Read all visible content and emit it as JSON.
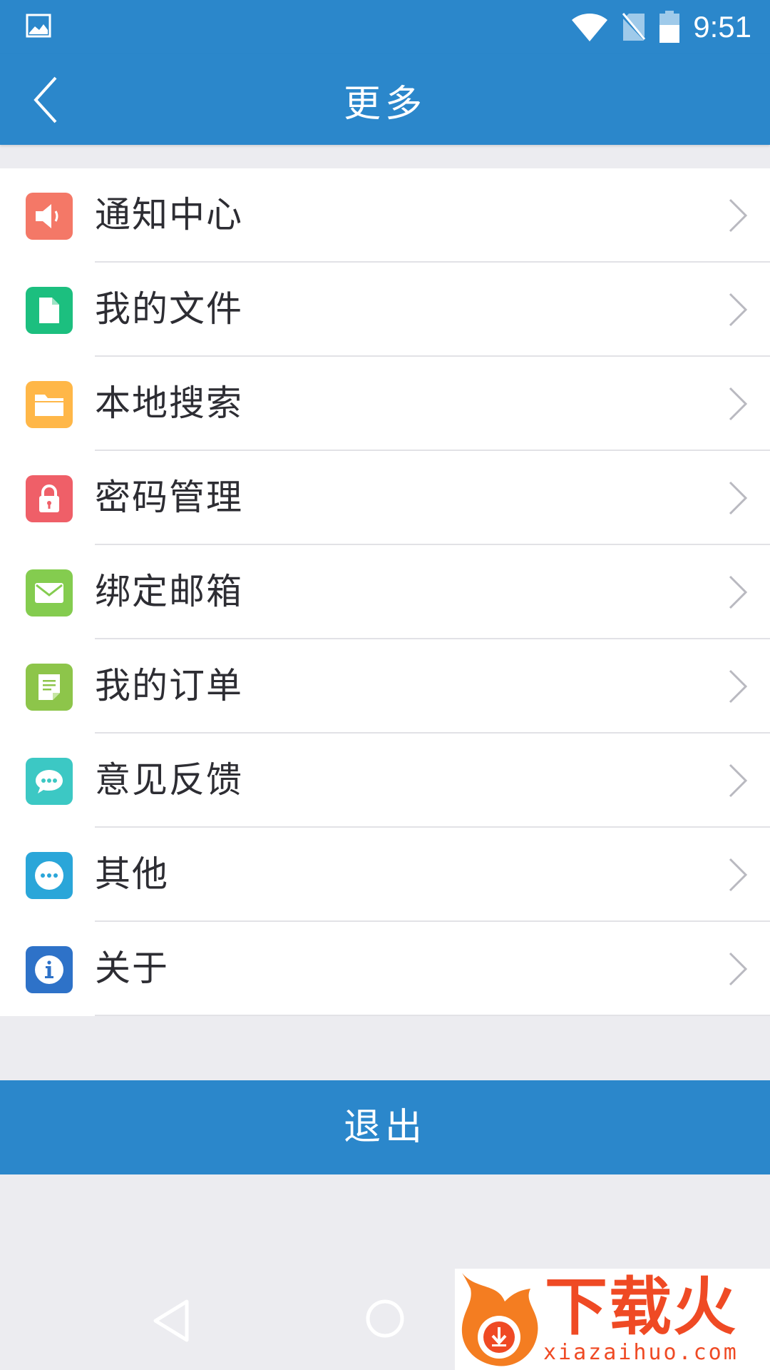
{
  "status_bar": {
    "time": "9:51",
    "icons": [
      "image-notification-icon",
      "wifi-icon",
      "no-sim-icon",
      "battery-icon"
    ]
  },
  "header": {
    "title": "更多",
    "back_icon": "chevron-left-icon"
  },
  "menu": {
    "items": [
      {
        "label": "通知中心",
        "icon": "speaker-icon",
        "color": "#f47867"
      },
      {
        "label": "我的文件",
        "icon": "file-icon",
        "color": "#1cbf7f"
      },
      {
        "label": "本地搜索",
        "icon": "folder-icon",
        "color": "#ffb748"
      },
      {
        "label": "密码管理",
        "icon": "lock-icon",
        "color": "#ef5f68"
      },
      {
        "label": "绑定邮箱",
        "icon": "mail-icon",
        "color": "#84cc4f"
      },
      {
        "label": "我的订单",
        "icon": "order-icon",
        "color": "#8dc54a"
      },
      {
        "label": "意见反馈",
        "icon": "chat-icon",
        "color": "#3cc8c4"
      },
      {
        "label": "其他",
        "icon": "more-icon",
        "color": "#2aa6d9"
      },
      {
        "label": "关于",
        "icon": "info-icon",
        "color": "#2e72c8"
      }
    ]
  },
  "logout": {
    "label": "退出"
  },
  "watermark": {
    "text": "下载火",
    "url": "xiazaihuo.com"
  },
  "colors": {
    "primary": "#2b87cb",
    "background": "#ececf0",
    "text": "#2d2d33",
    "chevron": "#b9b9c0",
    "watermark": "#ef4a24"
  }
}
